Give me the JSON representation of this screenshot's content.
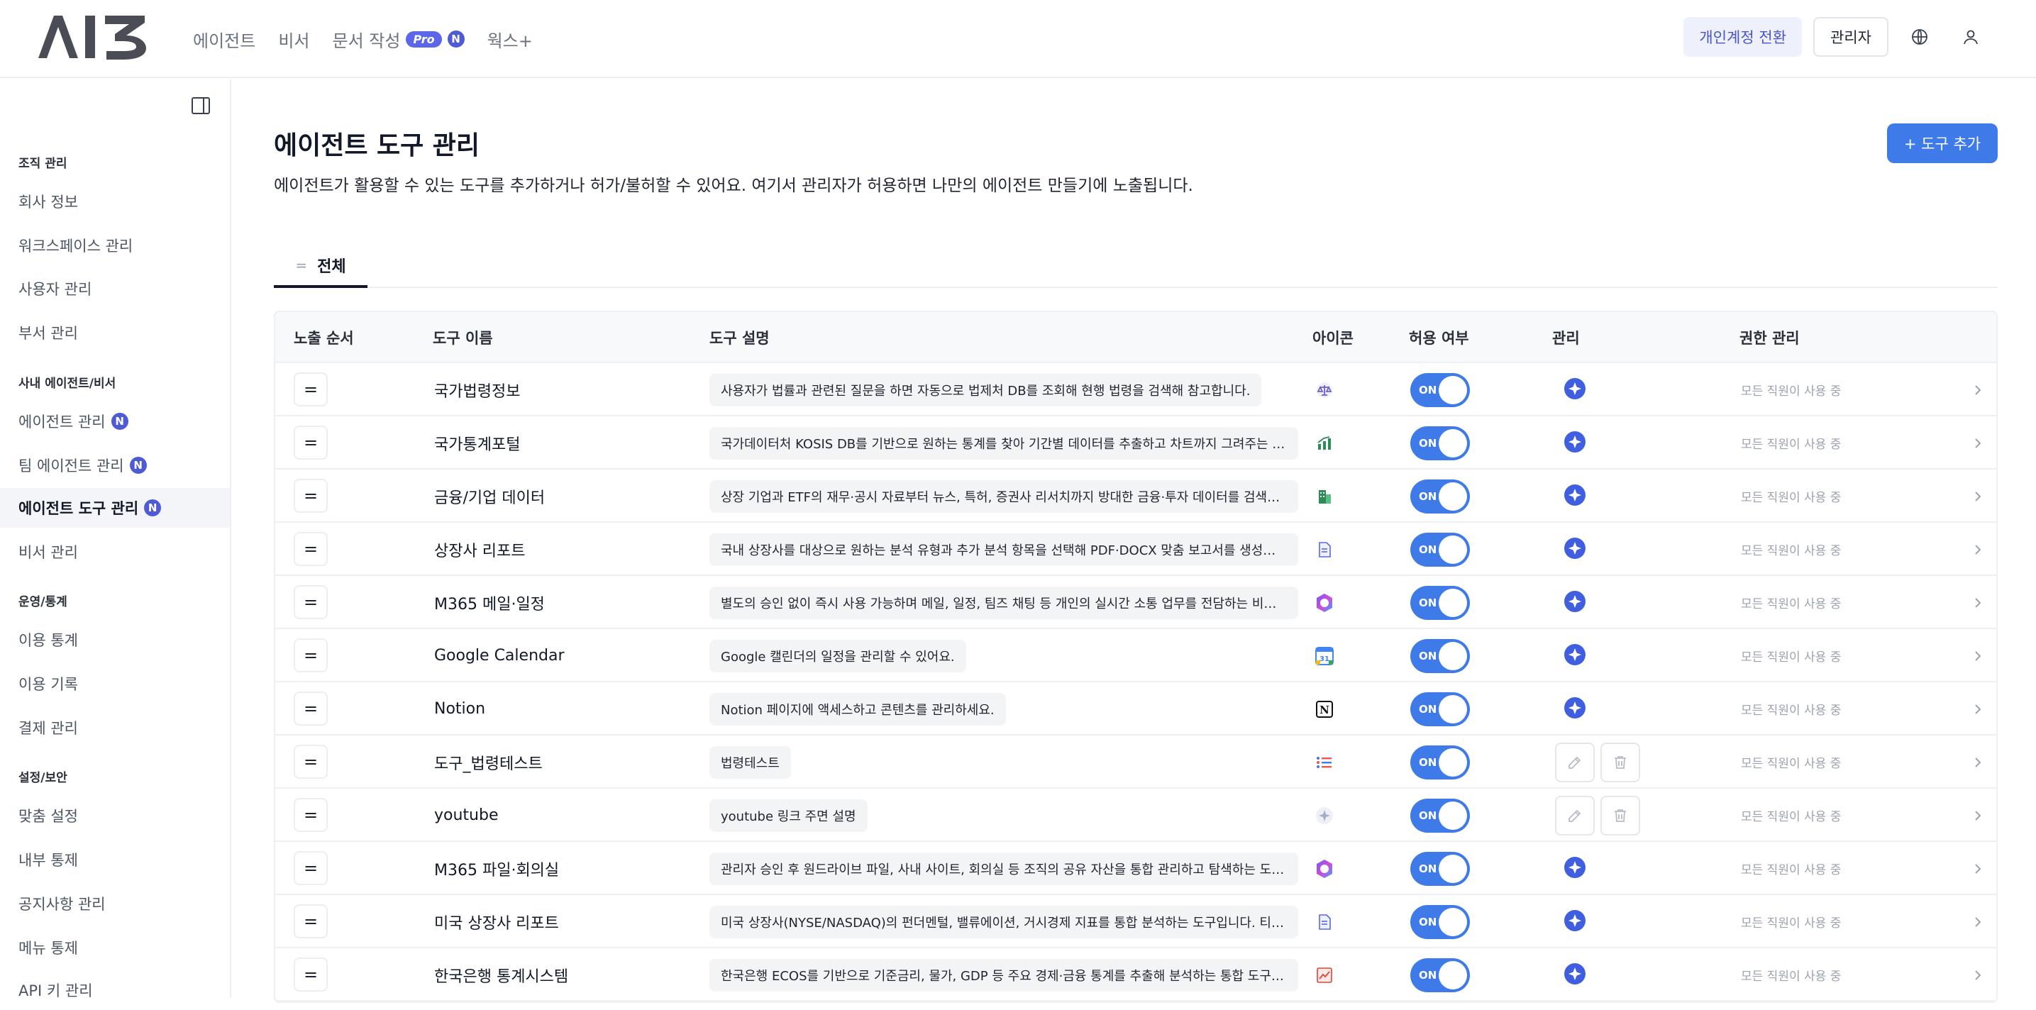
{
  "header": {
    "logo_text": "AI3",
    "nav": [
      {
        "label": "에이전트"
      },
      {
        "label": "비서"
      },
      {
        "label": "문서 작성",
        "badge_pro": "Pro",
        "badge_new": "N"
      },
      {
        "label": "웍스+"
      }
    ],
    "switch_label": "개인계정 전환",
    "admin_label": "관리자",
    "globe_icon": "globe-icon",
    "user_icon": "user-icon"
  },
  "sidebar": {
    "collapse_icon": "sidebar-toggle-icon",
    "sections": [
      {
        "title": "조직 관리",
        "items": [
          {
            "label": "회사 정보"
          },
          {
            "label": "워크스페이스 관리"
          },
          {
            "label": "사용자 관리"
          },
          {
            "label": "부서 관리"
          }
        ]
      },
      {
        "title": "사내 에이전트/비서",
        "items": [
          {
            "label": "에이전트 관리",
            "badge": "N"
          },
          {
            "label": "팀 에이전트 관리",
            "badge": "N"
          },
          {
            "label": "에이전트 도구 관리",
            "badge": "N",
            "active": true
          },
          {
            "label": "비서 관리"
          }
        ]
      },
      {
        "title": "운영/통계",
        "items": [
          {
            "label": "이용 통계"
          },
          {
            "label": "이용 기록"
          },
          {
            "label": "결제 관리"
          }
        ]
      },
      {
        "title": "설정/보안",
        "items": [
          {
            "label": "맞춤 설정"
          },
          {
            "label": "내부 통제"
          },
          {
            "label": "공지사항 관리"
          },
          {
            "label": "메뉴 통제"
          },
          {
            "label": "API 키 관리"
          }
        ]
      }
    ]
  },
  "main": {
    "title": "에이전트 도구 관리",
    "description": "에이전트가 활용할 수 있는 도구를 추가하거나 허가/불허할 수 있어요. 여기서 관리자가 허용하면 나만의 에이전트 만들기에 노출됩니다.",
    "add_button": "+ 도구 추가",
    "tab_label": "전체",
    "tab_handle": "=",
    "columns": [
      "노출 순서",
      "도구 이름",
      "도구 설명",
      "아이콘",
      "허용 여부",
      "관리",
      "권한 관리"
    ],
    "toggle_label": "ON",
    "drag_glyph": "=",
    "rows": [
      {
        "name": "국가법령정보",
        "desc": "사용자가 법률과 관련된 질문을 하면 자동으로 법제처 DB를 조회해 현행 법령을 검색해 참고합니다.",
        "icon": "scale-icon",
        "manage": "ai-icon",
        "perm": "모든 직원이 사용 중"
      },
      {
        "name": "국가통계포털",
        "desc": "국가데이터처 KOSIS DB를 기반으로 원하는 통계를 찾아 기간별 데이터를 추출하고 차트까지 그려주는 통합 분...",
        "icon": "chart-icon",
        "manage": "ai-icon",
        "perm": "모든 직원이 사용 중"
      },
      {
        "name": "금융/기업 데이터",
        "desc": "상장 기업과 ETF의 재무·공시 자료부터 뉴스, 특허, 증권사 리서치까지 방대한 금융·투자 데이터를 검색합니다.",
        "icon": "building-icon",
        "manage": "ai-icon",
        "perm": "모든 직원이 사용 중"
      },
      {
        "name": "상장사 리포트",
        "desc": "국내 상장사를 대상으로 원하는 분석 유형과 추가 분석 항목을 선택해 PDF·DOCX 맞춤 보고서를 생성합니다.",
        "icon": "report-icon",
        "manage": "ai-icon",
        "perm": "모든 직원이 사용 중"
      },
      {
        "name": "M365 메일·일정",
        "desc": "별도의 승인 없이 즉시 사용 가능하며 메일, 일정, 팀즈 채팅 등 개인의 실시간 소통 업무를 전담하는 비서 도구입...",
        "icon": "m365-icon",
        "manage": "ai-icon",
        "perm": "모든 직원이 사용 중"
      },
      {
        "name": "Google Calendar",
        "desc": "Google 캘린더의 일정을 관리할 수 있어요.",
        "icon": "google-calendar-icon",
        "icon_text": "31",
        "manage": "ai-icon",
        "perm": "모든 직원이 사용 중"
      },
      {
        "name": "Notion",
        "desc": "Notion 페이지에 액세스하고 콘텐츠를 관리하세요.",
        "icon": "notion-icon",
        "icon_text": "N",
        "manage": "ai-icon",
        "perm": "모든 직원이 사용 중"
      },
      {
        "name": "도구_법령테스트",
        "desc": "법령테스트",
        "icon": "list-icon",
        "manage": "edit-delete",
        "perm": "모든 직원이 사용 중"
      },
      {
        "name": "youtube",
        "desc": "youtube 링크 주면 설명",
        "icon": "sparkle-icon",
        "manage": "edit-delete",
        "perm": "모든 직원이 사용 중"
      },
      {
        "name": "M365 파일·회의실",
        "desc": "관리자 승인 후 원드라이브 파일, 사내 사이트, 회의실 등 조직의 공유 자산을 통합 관리하고 탐색하는 도구입니다....",
        "icon": "m365-icon",
        "manage": "ai-icon",
        "perm": "모든 직원이 사용 중"
      },
      {
        "name": "미국 상장사 리포트",
        "desc": "미국 상장사(NYSE/NASDAQ)의 펀더멘털, 밸류에이션, 거시경제 지표를 통합 분석하는 도구입니다. 티커나 기...",
        "icon": "report-icon",
        "manage": "ai-icon",
        "perm": "모든 직원이 사용 중"
      },
      {
        "name": "한국은행 통계시스템",
        "desc": "한국은행 ECOS를 기반으로 기준금리, 물가, GDP 등 주요 경제·금융 통계를 추출해 분석하는 통합 도구입니다. ...",
        "icon": "bank-chart-icon",
        "manage": "ai-icon",
        "perm": "모든 직원이 사용 중"
      }
    ]
  },
  "colors": {
    "accent": "#3f7be8",
    "badge": "#4f5bd5",
    "muted": "#9ca3af"
  }
}
